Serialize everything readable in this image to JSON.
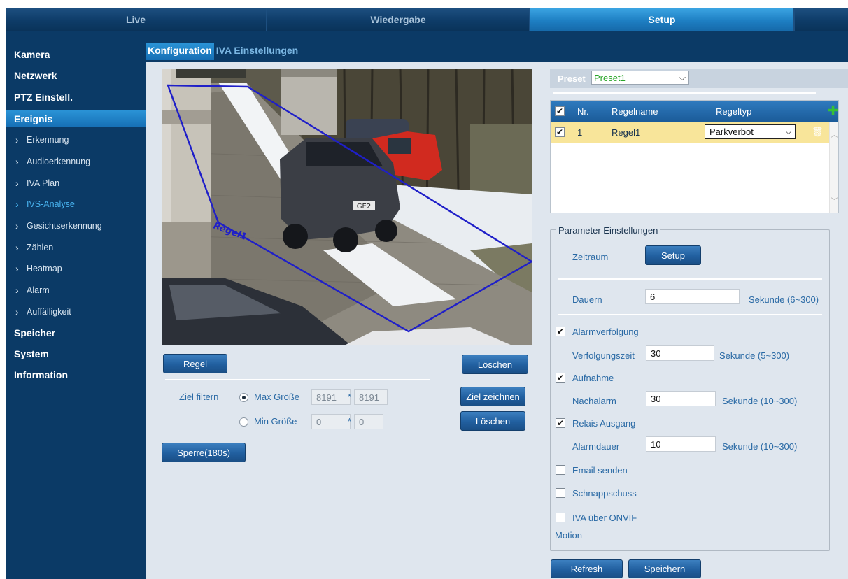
{
  "top_tabs": [
    {
      "label": "Live",
      "active": false
    },
    {
      "label": "Wiedergabe",
      "active": false
    },
    {
      "label": "Setup",
      "active": true
    }
  ],
  "sidebar": {
    "items": [
      {
        "label": "Kamera",
        "level": "main"
      },
      {
        "label": "Netzwerk",
        "level": "main"
      },
      {
        "label": "PTZ Einstell.",
        "level": "main"
      },
      {
        "label": "Ereignis",
        "level": "main",
        "active": true
      },
      {
        "label": "Erkennung",
        "level": "sub"
      },
      {
        "label": "Audioerkennung",
        "level": "sub"
      },
      {
        "label": "IVA Plan",
        "level": "sub"
      },
      {
        "label": "IVS-Analyse",
        "level": "sub",
        "active": true
      },
      {
        "label": "Gesichtserkennung",
        "level": "sub"
      },
      {
        "label": "Zählen",
        "level": "sub"
      },
      {
        "label": "Heatmap",
        "level": "sub"
      },
      {
        "label": "Alarm",
        "level": "sub"
      },
      {
        "label": "Auffälligkeit",
        "level": "sub"
      },
      {
        "label": "Speicher",
        "level": "main"
      },
      {
        "label": "System",
        "level": "main"
      },
      {
        "label": "Information",
        "level": "main"
      }
    ]
  },
  "sub_tabs": [
    {
      "label": "Konfiguration",
      "active": true
    },
    {
      "label": "IVA Einstellungen",
      "active": false
    }
  ],
  "video": {
    "rule_overlay_label": "Regel1",
    "plate_text": "GE2"
  },
  "left_panel": {
    "regel_button": "Regel",
    "loeschen_button": "Löschen",
    "ziel_filtern_label": "Ziel filtern",
    "max_label": "Max Größe",
    "max_w": "8191",
    "max_h": "8191",
    "min_label": "Min Größe",
    "min_w": "0",
    "min_h": "0",
    "times": "*",
    "ziel_zeichnen_button": "Ziel zeichnen",
    "loeschen2_button": "Löschen",
    "sperre_button": "Sperre(180s)",
    "size_mode": "max"
  },
  "preset": {
    "label": "Preset",
    "value": "Preset1"
  },
  "rules_table": {
    "headers": {
      "nr": "Nr.",
      "name": "Regelname",
      "type": "Regeltyp"
    },
    "rows": [
      {
        "checked": true,
        "nr": "1",
        "name": "Regel1",
        "type": "Parkverbot"
      }
    ]
  },
  "params": {
    "title": "Parameter Einstellungen",
    "zeitraum_label": "Zeitraum",
    "setup_button": "Setup",
    "dauern_label": "Dauern",
    "dauern_value": "6",
    "dauern_unit": "Sekunde (6~300)",
    "alarmverfolgung_label": "Alarmverfolgung",
    "alarmverfolgung_checked": true,
    "verfolgungszeit_label": "Verfolgungszeit",
    "verfolgungszeit_value": "30",
    "verfolgungszeit_unit": "Sekunde (5~300)",
    "aufnahme_label": "Aufnahme",
    "aufnahme_checked": true,
    "nachalarm_label": "Nachalarm",
    "nachalarm_value": "30",
    "nachalarm_unit": "Sekunde (10~300)",
    "relais_label": "Relais Ausgang",
    "relais_checked": true,
    "alarmdauer_label": "Alarmdauer",
    "alarmdauer_value": "10",
    "alarmdauer_unit": "Sekunde (10~300)",
    "email_label": "Email senden",
    "email_checked": false,
    "schnappschuss_label": "Schnappschuss",
    "schnappschuss_checked": false,
    "onvif_label": "IVA über ONVIF",
    "onvif_checked": false,
    "motion_label": "Motion"
  },
  "footer": {
    "refresh_button": "Refresh",
    "speichern_button": "Speichern"
  },
  "colors": {
    "nav_bg": "#0b3a66",
    "accent": "#1e7fc3",
    "content_bg": "#dfe6ee",
    "rule_polygon": "#1f1fc8",
    "selected_row": "#f8e59a"
  }
}
